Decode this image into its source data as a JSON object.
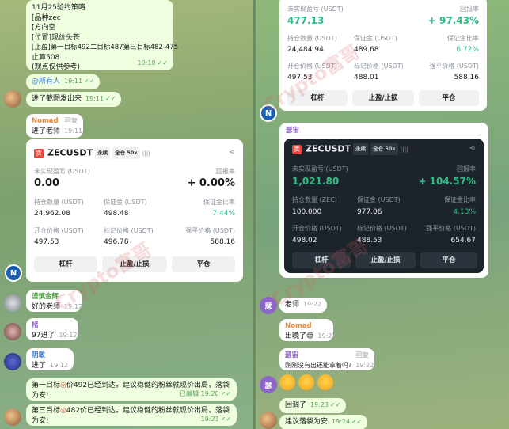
{
  "left": {
    "strategy": {
      "lines": [
        "11月25验约策略",
        "[品种zec",
        "[方向空",
        "[位置]现价头苍",
        "[止盈]第一目标492二目标487第三目标482-475",
        "止算508",
        "(观点仅供参考)"
      ],
      "time": "19:10"
    },
    "mention": {
      "text": "@所有人",
      "time": "19:11"
    },
    "m1": {
      "text": "进了截图发出来",
      "time": "19:11"
    },
    "m2": {
      "sender": "Nomad",
      "reply": "回复",
      "text": "进了老师",
      "time": "19:11"
    },
    "card": {
      "symbol": "ZECUSDT",
      "tag1": "永续",
      "tag2": "全仓 50x",
      "bars": "||||",
      "upnl_label": "未实现盈亏 (USDT)",
      "roe_label": "回报率",
      "upnl": "0.00",
      "roe": "+ 0.00%",
      "r2": {
        "l1": "持仓数量 (USDT)",
        "l2": "保证金 (USDT)",
        "l3": "保证金比率",
        "v1": "24,962.08",
        "v2": "498.48",
        "v3": "7.44%"
      },
      "r3": {
        "l1": "开仓价格 (USDT)",
        "l2": "标记价格 (USDT)",
        "l3": "强平价格 (USDT)",
        "v1": "497.53",
        "v2": "496.78",
        "v3": "588.16"
      },
      "btns": [
        "杠杆",
        "止盈/止损",
        "平仓"
      ]
    },
    "m3": {
      "sender": "谨慎金辉",
      "text": "好的老师",
      "time": "19:12"
    },
    "m4": {
      "sender": "楮",
      "text": "97进了",
      "time": "19:12"
    },
    "m5": {
      "sender": "阴敢",
      "text": "进了",
      "time": "19:12"
    },
    "m6": {
      "text": "第一目标",
      "text2": "价492已经到达，建议稳健的粉丝就现价出局，落袋为安!",
      "edited": "已编辑 19:20"
    },
    "m7": {
      "text": "第三目标",
      "text2": "482价已经到达，建议稳健的粉丝就现价出局，落袋为安!",
      "time": "19:21"
    }
  },
  "right": {
    "top": {
      "upnl_label": "未实现盈亏 (USDT)",
      "roe_label": "回报率",
      "upnl": "477.13",
      "roe": "+ 97.43%",
      "r2": {
        "l1": "持仓数量 (USDT)",
        "l2": "保证金 (USDT)",
        "l3": "保证金比率",
        "v1": "24,484.94",
        "v2": "489.68",
        "v3": "6.72%"
      },
      "r3": {
        "l1": "开仓价格 (USDT)",
        "l2": "标记价格 (USDT)",
        "l3": "强平价格 (USDT)",
        "v1": "497.53",
        "v2": "488.01",
        "v3": "588.16"
      },
      "btns": [
        "杠杆",
        "止盈/止损",
        "平仓"
      ]
    },
    "card2": {
      "sender": "瑟宙",
      "symbol": "ZECUSDT",
      "tag1": "永续",
      "tag2": "全仓 50x",
      "bars": "||||",
      "upnl_label": "未实现盈亏 (USDT)",
      "roe_label": "回报率",
      "upnl": "1,021.80",
      "roe": "+ 104.57%",
      "r2": {
        "l1": "持仓数量 (ZEC)",
        "l2": "保证金 (USDT)",
        "l3": "保证金比率",
        "v1": "100.000",
        "v2": "977.06",
        "v3": "4.13%"
      },
      "r3": {
        "l1": "开仓价格 (USDT)",
        "l2": "标记价格 (USDT)",
        "l3": "强平价格 (USDT)",
        "v1": "498.02",
        "v2": "488.53",
        "v3": "654.67"
      },
      "btns": [
        "杠杆",
        "止盈/止损",
        "平仓"
      ]
    },
    "m1": {
      "text": "老师",
      "time": "19:22"
    },
    "m2": {
      "sender": "Nomad",
      "text": "出晚了",
      "time": "19:22"
    },
    "m3": {
      "sender": "瑟宙",
      "reply": "回复",
      "text": "刚刚没有出还能拿着吗?",
      "time": "19:22"
    },
    "m4": {
      "text": "回调了",
      "time": "19:23"
    },
    "m5": {
      "text": "建议落袋为安",
      "time": "19:24"
    }
  },
  "avatars": {
    "nomad": "N",
    "lady": "瑟"
  },
  "watermark": "Crypto富哥",
  "colors": {
    "profit": "#2ebd85",
    "name_orange": "#e5883a",
    "name_green": "#4f9e3f",
    "name_purple": "#8d65c8",
    "name_blue": "#3b7bd0",
    "logo": "#e5483f"
  }
}
